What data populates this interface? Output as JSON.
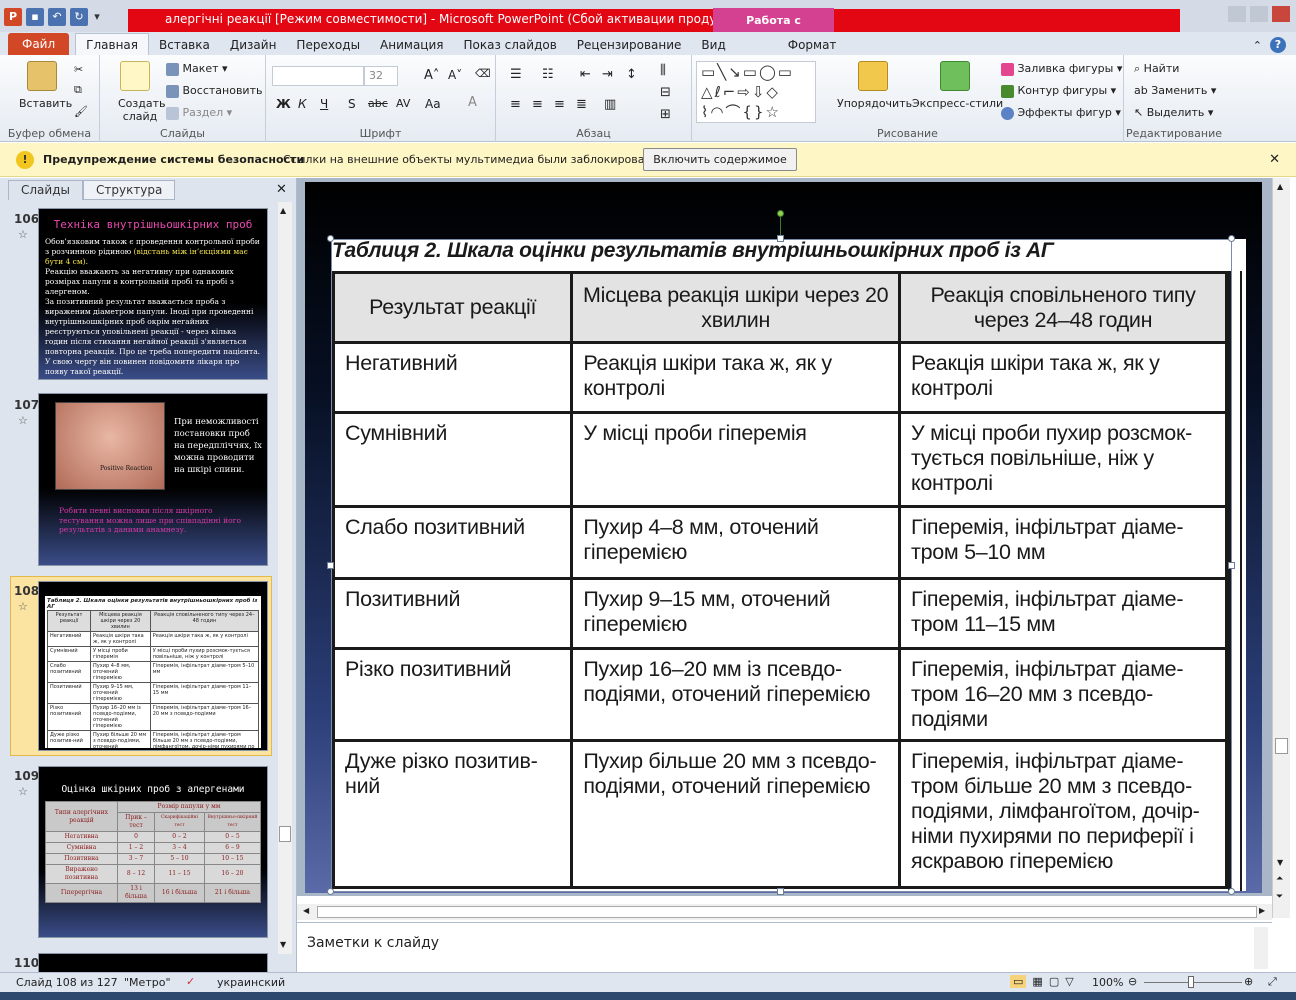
{
  "window": {
    "title": "алергічні реакції [Режим совместимости] - Microsoft PowerPoint (Сбой активации продукта)",
    "context_tab_title": "Работа с рисунками",
    "app_icon": "P"
  },
  "tabs": [
    "Файл",
    "Главная",
    "Вставка",
    "Дизайн",
    "Переходы",
    "Анимация",
    "Показ слайдов",
    "Рецензирование",
    "Вид",
    "Формат"
  ],
  "ribbon": {
    "clipboard": {
      "paste": "Вставить",
      "label": "Буфер обмена"
    },
    "slides": {
      "new_slide": "Создать слайд",
      "layout": "Макет",
      "reset": "Восстановить",
      "section": "Раздел",
      "label": "Слайды"
    },
    "font": {
      "size": "32",
      "label": "Шрифт",
      "bold": "Ж",
      "italic": "К",
      "underline": "Ч",
      "shadow": "S",
      "strike": "abc",
      "spacing": "AV",
      "case": "Aa"
    },
    "paragraph": {
      "label": "Абзац"
    },
    "drawing": {
      "arrange": "Упорядочить",
      "quick_styles": "Экспресс-стили",
      "fill": "Заливка фигуры",
      "outline": "Контур фигуры",
      "effects": "Эффекты фигур",
      "label": "Рисование"
    },
    "editing": {
      "find": "Найти",
      "replace": "Заменить",
      "select": "Выделить",
      "label": "Редактирование"
    }
  },
  "security": {
    "title": "Предупреждение системы безопасности",
    "message": "Ссылки на внешние объекты мультимедиа были заблокированы",
    "button": "Включить содержимое"
  },
  "panel": {
    "tabs": [
      "Слайды",
      "Структура"
    ]
  },
  "thumbs": {
    "s106": {
      "num": "106",
      "title": "Техніка внутрішньошкірних проб",
      "body_a": "Обов’язковим також є проведення контрольної проби з розчинною рідиною ",
      "body_hl": "(відстань між ін’єкціями має бути 4 см).",
      "body_b": "Реакцію вважають за негативну при однакових розмірах папули в контрольній пробі та пробі з алергеном.\nЗа позитивний результат вважається проба з вираженим діаметром папули. Іноді при проведенні внутрішньошкірних проб окрім негайних реєструються уповільнені реакції - через кілька годин після стихання негайної реакції з'являється повторна реакція. Про це треба попередити пацієнта. У свою чергу він повинен повідомити лікаря про появу такої реакції."
    },
    "s107": {
      "num": "107",
      "photo_label": "Positive Reaction",
      "text": "При неможливості постановки проб на передпліччях, їх можна проводити на шкірі спини.",
      "note": "Робити певні висновки після шкірного тестування можна лише при співпадінні його результатів з даними анамнезу."
    },
    "s108": {
      "num": "108"
    },
    "s109": {
      "num": "109",
      "title": "Оцінка шкірних проб з алергенами",
      "head_type": "Типи алергічних реакцій",
      "head_size": "Розмір папули у мм",
      "sub": [
        "Прик – тест",
        "Скарифікаційні тест",
        "Внутрішньо-шкірний тест"
      ],
      "rows": [
        [
          "Негативна",
          "0",
          "0 – 2",
          "0 – 5"
        ],
        [
          "Сумнівна",
          "1 – 2",
          "3 – 4",
          "6 – 9"
        ],
        [
          "Позитивна",
          "3 – 7",
          "5 – 10",
          "10 – 15"
        ],
        [
          "Виражено позитивна",
          "8 – 12",
          "11 – 15",
          "16 – 20"
        ],
        [
          "Гіперергічна",
          "13 і більша",
          "16 і більша",
          "21 і більша"
        ]
      ]
    },
    "s110": {
      "num": "110"
    }
  },
  "slide": {
    "caption": "Таблиця 2. Шкала оцінки результатів внутрішньошкірних проб із АГ",
    "headers": [
      "Результат реакції",
      "Місцева реакція шкіри через 20 хвилин",
      "Реакція сповільненого типу через 24–48 годин"
    ],
    "rows": [
      [
        "Негативний",
        "Реакція шкіри така ж, як у контролі",
        "Реакція шкіри така ж, як у контролі"
      ],
      [
        "Сумнівний",
        "У місці проби гіперемія",
        "У місці проби пухир розсмок-тується повільніше, ніж у контролі"
      ],
      [
        "Слабо позитивний",
        "Пухир 4–8 мм, оточений гіперемією",
        "Гіперемія, інфільтрат діаме-тром 5–10 мм"
      ],
      [
        "Позитивний",
        "Пухир 9–15 мм, оточений гіперемією",
        "Гіперемія, інфільтрат діаме-тром 11–15 мм"
      ],
      [
        "Різко позитивний",
        "Пухир 16–20 мм із псевдо-подіями, оточений гіперемією",
        "Гіперемія, інфільтрат діаме-тром 16–20 мм з псевдо-подіями"
      ],
      [
        "Дуже різко позитив-ний",
        "Пухир більше 20 мм з псевдо-подіями, оточений гіперемією",
        "Гіперемія, інфільтрат діаме-тром більше 20 мм з псевдо-подіями, лімфангоїтом, дочір-німи пухирями по периферії і яскравою гіперемією"
      ]
    ]
  },
  "notes": {
    "placeholder": "Заметки к слайду"
  },
  "status": {
    "slide": "Слайд 108 из 127",
    "theme": "\"Метро\"",
    "lang": "украинский",
    "zoom": "100%"
  }
}
